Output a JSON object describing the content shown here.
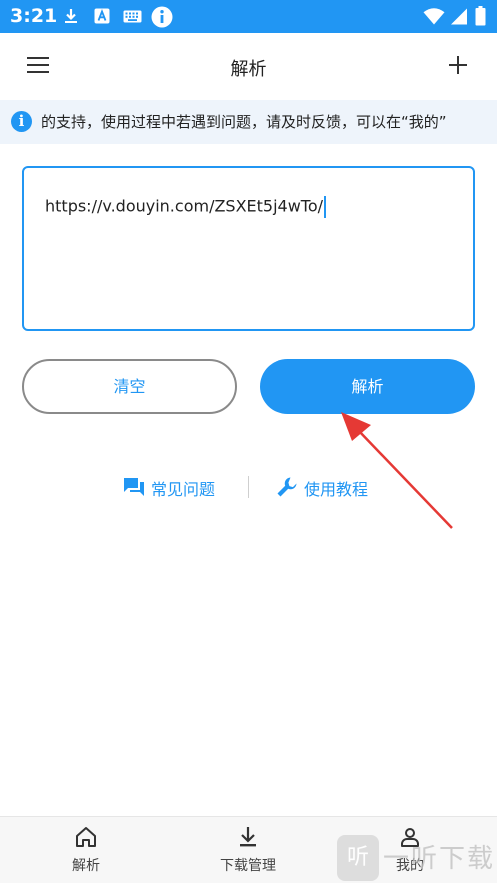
{
  "status_bar": {
    "time": "3:21",
    "background": "#2196f3",
    "left_icons": [
      "download-icon",
      "a-app-icon",
      "keyboard-icon",
      "info-icon"
    ],
    "right_icons": [
      "wifi-icon",
      "signal-icon",
      "battery-icon"
    ]
  },
  "app_bar": {
    "menu_icon": "menu-icon",
    "title": "解析",
    "add_icon": "plus-icon"
  },
  "notice": {
    "icon": "info-icon",
    "info_glyph": "i",
    "text": "的支持，使用过程中若遇到问题，请及时反馈，可以在“我的”"
  },
  "url_input": {
    "value": "https://v.douyin.com/ZSXEt5j4wTo/"
  },
  "buttons": {
    "clear": "清空",
    "parse": "解析"
  },
  "help_links": {
    "faq": {
      "icon": "chat-icon",
      "label": "常见问题"
    },
    "tutorial": {
      "icon": "wrench-icon",
      "label": "使用教程"
    }
  },
  "bottom_nav": [
    {
      "icon": "home-icon",
      "label": "解析"
    },
    {
      "icon": "download-icon",
      "label": "下载管理"
    },
    {
      "icon": "person-icon",
      "label": "我的"
    }
  ],
  "watermark": {
    "badge": "听",
    "text": "一听下载"
  },
  "colors": {
    "accent": "#2196f3",
    "annotation_arrow": "#e53935"
  }
}
